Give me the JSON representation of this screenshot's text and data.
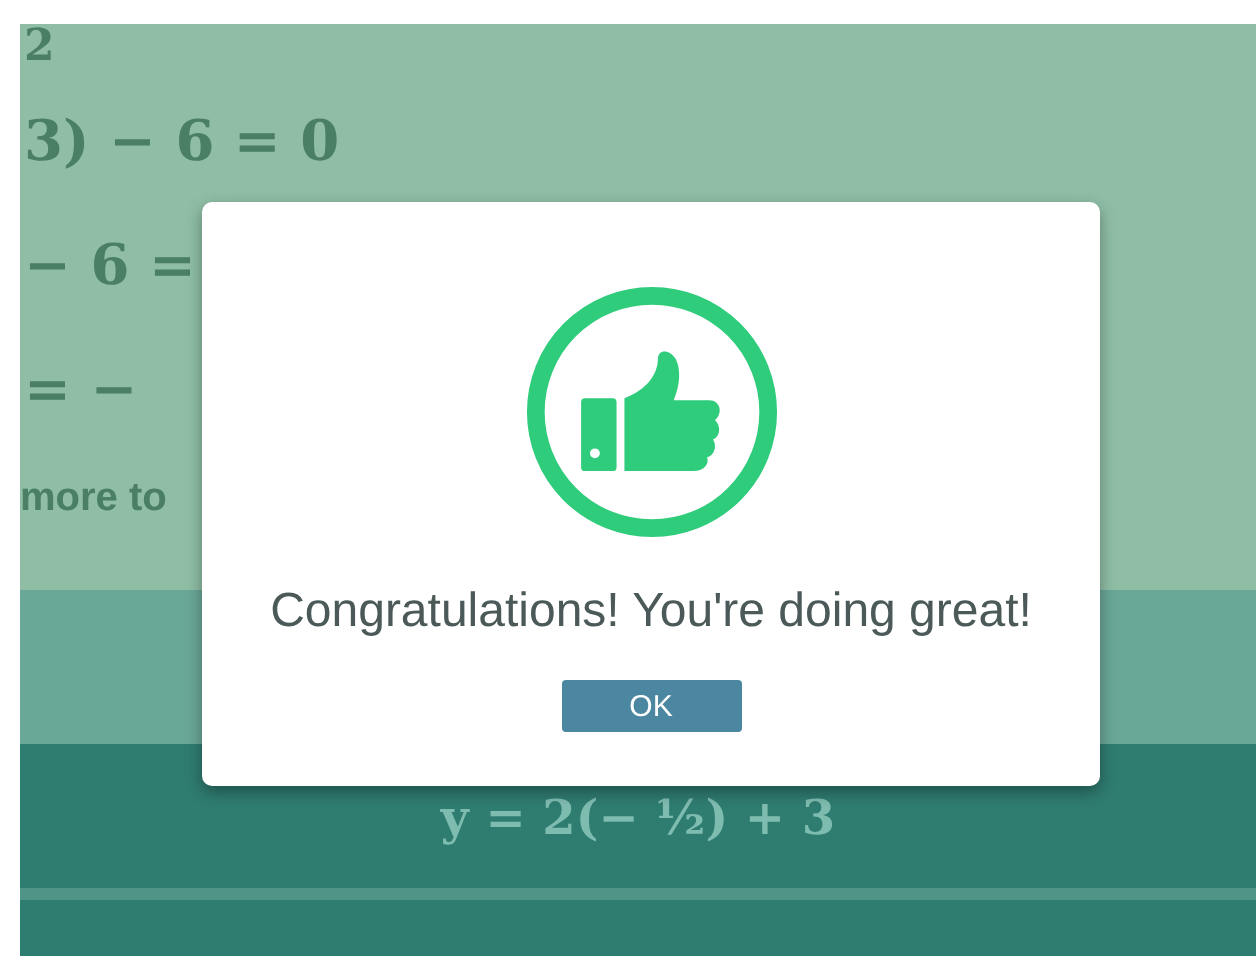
{
  "background": {
    "lines": [
      "2",
      "3) − 6 = 0",
      "− 6 =",
      "= −",
      "more to"
    ],
    "answer_rows": [
      "y = 2(− ½) + 3"
    ]
  },
  "dialog": {
    "message": "Congratulations! You're doing great!",
    "buttons": [
      "OK"
    ]
  }
}
